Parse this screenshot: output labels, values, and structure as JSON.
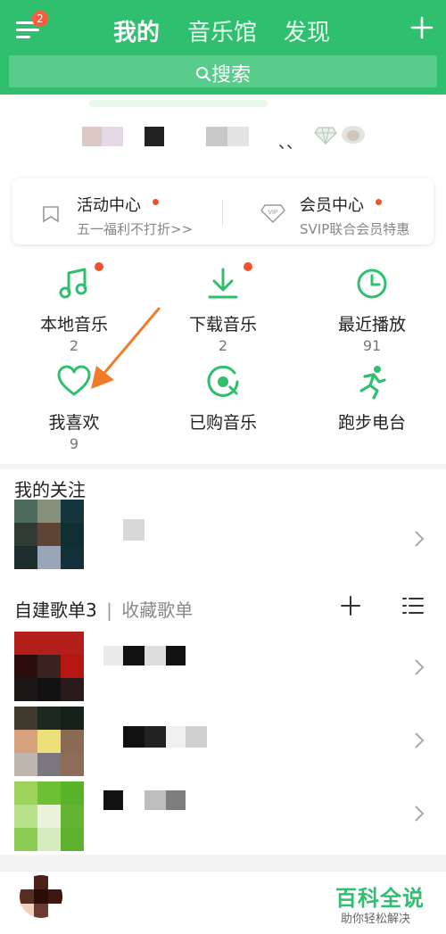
{
  "header": {
    "menu_badge": "2",
    "tabs": [
      "我的",
      "音乐馆",
      "发现"
    ],
    "search_label": "搜索"
  },
  "activity_card": {
    "left_title": "活动中心",
    "left_subtitle": "五一福利不打折>>",
    "right_title": "会员中心",
    "right_subtitle": "SVIP联合会员特惠",
    "vip_badge": "VIP"
  },
  "grid": [
    {
      "label": "本地音乐",
      "count": "2",
      "icon": "music-note-icon",
      "dot": true
    },
    {
      "label": "下载音乐",
      "count": "2",
      "icon": "download-icon",
      "dot": true
    },
    {
      "label": "最近播放",
      "count": "91",
      "icon": "clock-icon",
      "dot": false
    },
    {
      "label": "我喜欢",
      "count": "9",
      "icon": "heart-icon",
      "dot": false
    },
    {
      "label": "已购音乐",
      "count": "",
      "icon": "purchased-disc-icon",
      "dot": false
    },
    {
      "label": "跑步电台",
      "count": "",
      "icon": "running-icon",
      "dot": false
    }
  ],
  "follow": {
    "title": "我的关注"
  },
  "playlists": {
    "created_label": "自建歌单3",
    "separator": "|",
    "collected_label": "收藏歌单"
  },
  "watermark": {
    "title": "百科全说",
    "subtitle": "助你轻松解决"
  },
  "colors": {
    "brand_green": "#2fbf6e",
    "search_green": "#58cd8b",
    "red_dot": "#f0522f",
    "arrow_orange": "#f07c2a"
  }
}
